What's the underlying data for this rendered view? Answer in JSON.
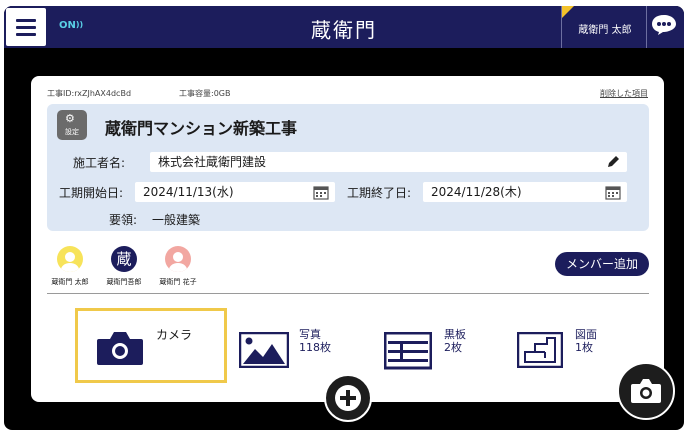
{
  "header": {
    "status": "ON",
    "logo": "蔵衛門",
    "user_name": "蔵衛門 太郎"
  },
  "project": {
    "id_label": "工事ID:rxZJhAX4dcBd",
    "capacity_label": "工事容量:0GB",
    "deleted_items_link": "削除した項目",
    "settings_label": "設定",
    "title": "蔵衛門マンション新築工事",
    "contractor_label": "施工者名:",
    "contractor_value": "株式会社蔵衛門建設",
    "start_label": "工期開始日:",
    "start_value": "2024/11/13(水)",
    "end_label": "工期終了日:",
    "end_value": "2024/11/28(木)",
    "summary_label": "要領:",
    "summary_value": "一般建築"
  },
  "members": [
    {
      "name": "蔵衛門 太郎",
      "avatar_color": "#f7e35a"
    },
    {
      "name": "蔵衛門吾郎",
      "avatar_color": "#1c1d5c",
      "avatar_text": "蔵"
    },
    {
      "name": "蔵衛門 花子",
      "avatar_color": "#f2a7a1"
    }
  ],
  "add_member_label": "メンバー追加",
  "actions": {
    "camera": {
      "label": "カメラ",
      "icon": "camera-icon"
    },
    "photos": {
      "label": "写真",
      "count": "118枚",
      "icon": "picture-icon"
    },
    "blackboard": {
      "label": "黒板",
      "count": "2枚",
      "icon": "blackboard-icon"
    },
    "drawings": {
      "label": "図面",
      "count": "1枚",
      "icon": "floor-plan-icon"
    }
  },
  "colors": {
    "navy": "#1c1d5c",
    "info_bg": "#dde7f4",
    "highlight": "#f0c94a"
  }
}
